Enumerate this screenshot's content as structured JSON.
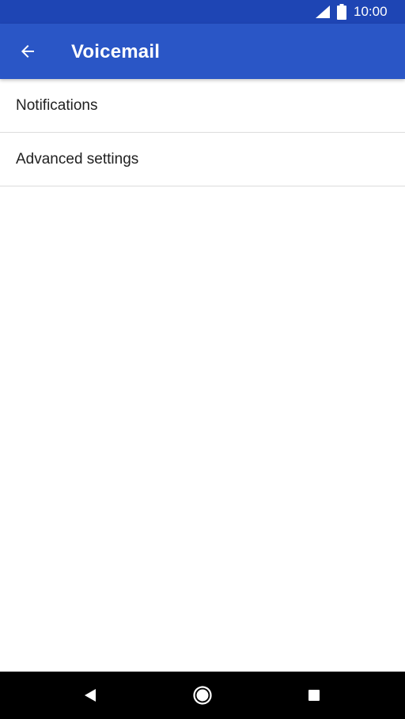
{
  "status_bar": {
    "time": "10:00",
    "icons": [
      "signal-icon",
      "battery-icon"
    ]
  },
  "app_bar": {
    "title": "Voicemail",
    "back_icon": "arrow-back-icon"
  },
  "settings": {
    "items": [
      {
        "label": "Notifications"
      },
      {
        "label": "Advanced settings"
      }
    ]
  },
  "nav_bar": {
    "icons": [
      "nav-back-icon",
      "nav-home-icon",
      "nav-recents-icon"
    ]
  },
  "colors": {
    "status_bar": "#1e45b4",
    "app_bar": "#2a56c6",
    "background": "#ffffff",
    "text": "#212121",
    "divider": "#dcdcdc",
    "nav_bar": "#000000"
  }
}
